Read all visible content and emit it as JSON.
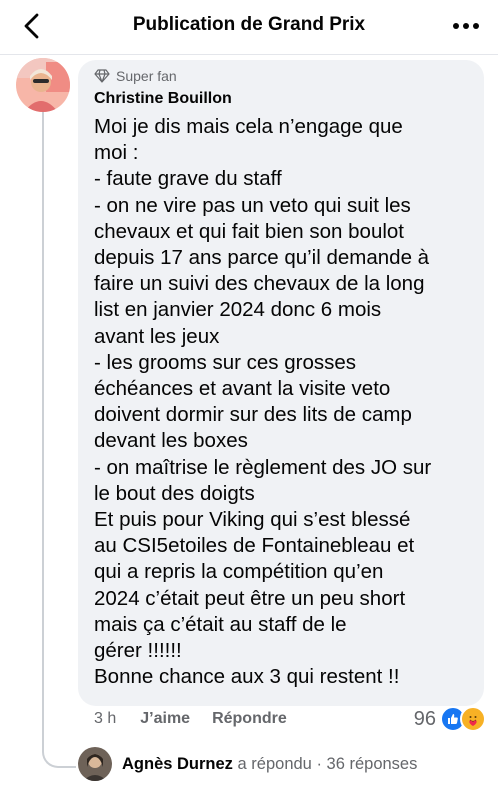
{
  "header": {
    "title": "Publication de Grand Prix"
  },
  "comment": {
    "badge": "Super fan",
    "author": "Christine Bouillon",
    "lines": [
      "Moi je dis mais cela n’engage que",
      "moi :",
      "- faute grave du staff",
      "- on ne vire pas un veto qui suit les",
      "chevaux et qui fait bien son boulot",
      "depuis 17 ans parce qu’il demande à",
      "faire un suivi des chevaux  de la long",
      "list en janvier 2024 donc 6 mois",
      "avant les jeux",
      "- les grooms sur ces grosses",
      "échéances et avant la visite veto",
      "doivent dormir sur des lits de camp",
      "devant les boxes",
      "- on maîtrise le règlement des JO sur",
      "le bout des doigts",
      "Et puis pour Viking qui s’est blessé",
      "au CSI5etoiles de Fontainebleau et",
      "qui a repris la compétition qu’en",
      "2024 c’était peut être un peu short",
      "mais ça c’était au staff de le",
      "gérer !!!!!!",
      "Bonne chance aux 3 qui restent !!"
    ],
    "time": "3 h",
    "like_label": "J’aime",
    "reply_label": "Répondre",
    "reaction_count": "96"
  },
  "reply_summary": {
    "name": "Agnès Durnez",
    "action": "a répondu",
    "separator": "·",
    "count": "36 réponses"
  },
  "icons": {
    "back": "chevron-left-icon",
    "more": "more-horizontal-icon",
    "badge": "diamond-icon",
    "like": "like-reaction-icon",
    "care": "care-reaction-icon"
  },
  "colors": {
    "like_blue": "#1877f2",
    "care_yellow": "#f7b125",
    "bubble_bg": "#f0f2f5",
    "secondary_text": "#65676b"
  }
}
